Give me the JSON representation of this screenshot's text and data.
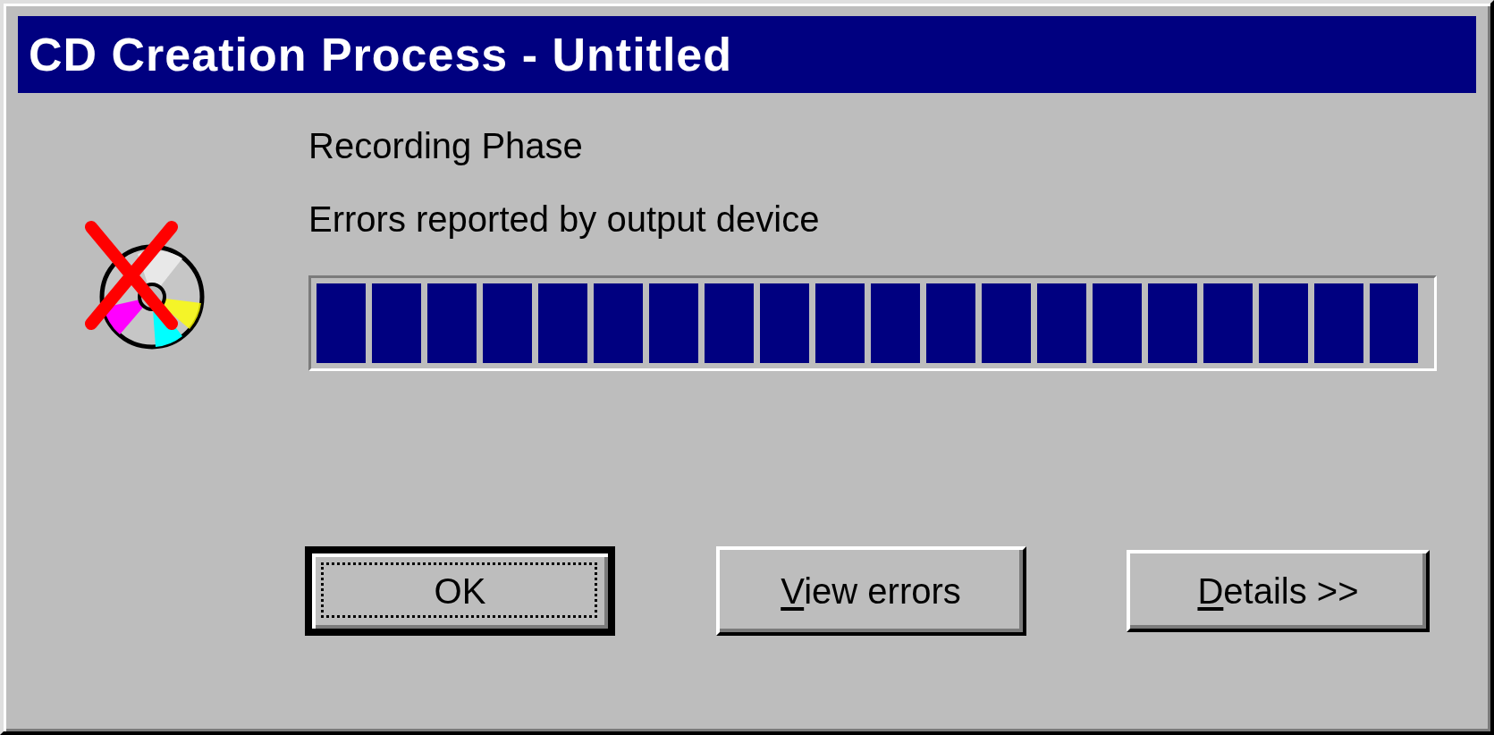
{
  "window": {
    "title": "CD Creation Process - Untitled"
  },
  "phase": "Recording Phase",
  "status": "Errors reported by output device",
  "progress": {
    "level": 0.99
  },
  "buttons": [
    {
      "label": "OK",
      "default": true,
      "mnemonic": false
    },
    {
      "label": "View errors",
      "default": false,
      "mnemonic": true
    },
    {
      "label": "Details >>",
      "default": false,
      "mnemonic": true
    }
  ]
}
